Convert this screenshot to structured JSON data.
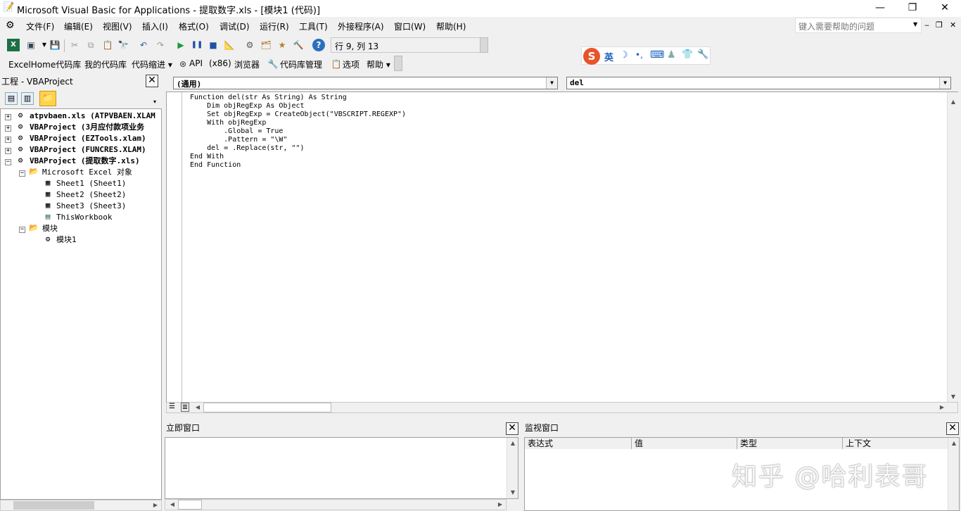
{
  "window": {
    "title": "Microsoft Visual Basic for Applications - 提取数字.xls - [模块1 (代码)]",
    "minimize": "—",
    "restore": "❐",
    "close": "✕"
  },
  "menu": {
    "items": [
      "文件(F)",
      "编辑(E)",
      "视图(V)",
      "插入(I)",
      "格式(O)",
      "调试(D)",
      "运行(R)",
      "工具(T)",
      "外接程序(A)",
      "窗口(W)",
      "帮助(H)"
    ],
    "help_placeholder": "键入需要帮助的问题",
    "child_min": "‒",
    "child_restore": "❐",
    "child_close": "✕"
  },
  "toolbar1": {
    "position": "行 9, 列 13"
  },
  "toolbar2": {
    "items": [
      "ExcelHome代码库",
      "我的代码库",
      "代码缩进 ▾",
      "API",
      "(x86)",
      "浏览器",
      "代码库管理",
      "选项",
      "帮助 ▾"
    ]
  },
  "ime": {
    "logo": "S",
    "lang": "英",
    "icons": [
      "☽",
      "•,",
      "⌨",
      "♟",
      "👕",
      "🔧"
    ]
  },
  "project": {
    "title": "工程 - VBAProject",
    "nodes": [
      {
        "label": "atpvbaen.xls (ATPVBAEN.XLAM",
        "bold": true,
        "expander": "+"
      },
      {
        "label": "VBAProject (3月应付款项业务",
        "bold": true,
        "expander": "+"
      },
      {
        "label": "VBAProject (EZTools.xlam)",
        "bold": true,
        "expander": "+"
      },
      {
        "label": "VBAProject (FUNCRES.XLAM)",
        "bold": true,
        "expander": "+"
      },
      {
        "label": "VBAProject (提取数字.xls)",
        "bold": true,
        "expander": "−"
      },
      {
        "label": "Microsoft Excel 对象",
        "bold": false,
        "expander": "−"
      },
      {
        "label": "Sheet1 (Sheet1)",
        "bold": false,
        "expander": ""
      },
      {
        "label": "Sheet2 (Sheet2)",
        "bold": false,
        "expander": ""
      },
      {
        "label": "Sheet3 (Sheet3)",
        "bold": false,
        "expander": ""
      },
      {
        "label": "ThisWorkbook",
        "bold": false,
        "expander": ""
      },
      {
        "label": "模块",
        "bold": false,
        "expander": "−"
      },
      {
        "label": "模块1",
        "bold": false,
        "expander": ""
      }
    ]
  },
  "editor": {
    "object_combo": "(通用)",
    "proc_combo": "del",
    "code": "Function del(str As String) As String\n    Dim objRegExp As Object\n    Set objRegExp = CreateObject(\"VBSCRIPT.REGEXP\")\n    With objRegExp\n        .Global = True\n        .Pattern = \"\\W\"\n    del = .Replace(str, \"\")\nEnd With\nEnd Function"
  },
  "immediate": {
    "title": "立即窗口"
  },
  "watch": {
    "title": "监视窗口",
    "columns": [
      "表达式",
      "值",
      "类型",
      "上下文"
    ]
  },
  "watermark": "知乎 @哈利表哥"
}
